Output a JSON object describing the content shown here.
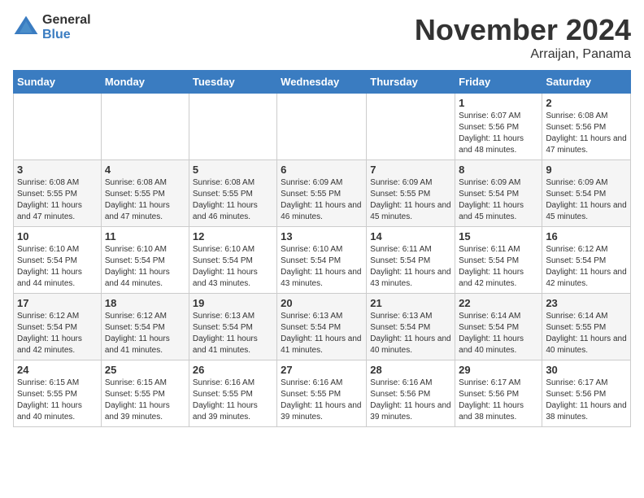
{
  "logo": {
    "general": "General",
    "blue": "Blue"
  },
  "title": "November 2024",
  "location": "Arraijan, Panama",
  "days_of_week": [
    "Sunday",
    "Monday",
    "Tuesday",
    "Wednesday",
    "Thursday",
    "Friday",
    "Saturday"
  ],
  "weeks": [
    [
      {
        "day": "",
        "info": ""
      },
      {
        "day": "",
        "info": ""
      },
      {
        "day": "",
        "info": ""
      },
      {
        "day": "",
        "info": ""
      },
      {
        "day": "",
        "info": ""
      },
      {
        "day": "1",
        "info": "Sunrise: 6:07 AM\nSunset: 5:56 PM\nDaylight: 11 hours and 48 minutes."
      },
      {
        "day": "2",
        "info": "Sunrise: 6:08 AM\nSunset: 5:56 PM\nDaylight: 11 hours and 47 minutes."
      }
    ],
    [
      {
        "day": "3",
        "info": "Sunrise: 6:08 AM\nSunset: 5:55 PM\nDaylight: 11 hours and 47 minutes."
      },
      {
        "day": "4",
        "info": "Sunrise: 6:08 AM\nSunset: 5:55 PM\nDaylight: 11 hours and 47 minutes."
      },
      {
        "day": "5",
        "info": "Sunrise: 6:08 AM\nSunset: 5:55 PM\nDaylight: 11 hours and 46 minutes."
      },
      {
        "day": "6",
        "info": "Sunrise: 6:09 AM\nSunset: 5:55 PM\nDaylight: 11 hours and 46 minutes."
      },
      {
        "day": "7",
        "info": "Sunrise: 6:09 AM\nSunset: 5:55 PM\nDaylight: 11 hours and 45 minutes."
      },
      {
        "day": "8",
        "info": "Sunrise: 6:09 AM\nSunset: 5:54 PM\nDaylight: 11 hours and 45 minutes."
      },
      {
        "day": "9",
        "info": "Sunrise: 6:09 AM\nSunset: 5:54 PM\nDaylight: 11 hours and 45 minutes."
      }
    ],
    [
      {
        "day": "10",
        "info": "Sunrise: 6:10 AM\nSunset: 5:54 PM\nDaylight: 11 hours and 44 minutes."
      },
      {
        "day": "11",
        "info": "Sunrise: 6:10 AM\nSunset: 5:54 PM\nDaylight: 11 hours and 44 minutes."
      },
      {
        "day": "12",
        "info": "Sunrise: 6:10 AM\nSunset: 5:54 PM\nDaylight: 11 hours and 43 minutes."
      },
      {
        "day": "13",
        "info": "Sunrise: 6:10 AM\nSunset: 5:54 PM\nDaylight: 11 hours and 43 minutes."
      },
      {
        "day": "14",
        "info": "Sunrise: 6:11 AM\nSunset: 5:54 PM\nDaylight: 11 hours and 43 minutes."
      },
      {
        "day": "15",
        "info": "Sunrise: 6:11 AM\nSunset: 5:54 PM\nDaylight: 11 hours and 42 minutes."
      },
      {
        "day": "16",
        "info": "Sunrise: 6:12 AM\nSunset: 5:54 PM\nDaylight: 11 hours and 42 minutes."
      }
    ],
    [
      {
        "day": "17",
        "info": "Sunrise: 6:12 AM\nSunset: 5:54 PM\nDaylight: 11 hours and 42 minutes."
      },
      {
        "day": "18",
        "info": "Sunrise: 6:12 AM\nSunset: 5:54 PM\nDaylight: 11 hours and 41 minutes."
      },
      {
        "day": "19",
        "info": "Sunrise: 6:13 AM\nSunset: 5:54 PM\nDaylight: 11 hours and 41 minutes."
      },
      {
        "day": "20",
        "info": "Sunrise: 6:13 AM\nSunset: 5:54 PM\nDaylight: 11 hours and 41 minutes."
      },
      {
        "day": "21",
        "info": "Sunrise: 6:13 AM\nSunset: 5:54 PM\nDaylight: 11 hours and 40 minutes."
      },
      {
        "day": "22",
        "info": "Sunrise: 6:14 AM\nSunset: 5:54 PM\nDaylight: 11 hours and 40 minutes."
      },
      {
        "day": "23",
        "info": "Sunrise: 6:14 AM\nSunset: 5:55 PM\nDaylight: 11 hours and 40 minutes."
      }
    ],
    [
      {
        "day": "24",
        "info": "Sunrise: 6:15 AM\nSunset: 5:55 PM\nDaylight: 11 hours and 40 minutes."
      },
      {
        "day": "25",
        "info": "Sunrise: 6:15 AM\nSunset: 5:55 PM\nDaylight: 11 hours and 39 minutes."
      },
      {
        "day": "26",
        "info": "Sunrise: 6:16 AM\nSunset: 5:55 PM\nDaylight: 11 hours and 39 minutes."
      },
      {
        "day": "27",
        "info": "Sunrise: 6:16 AM\nSunset: 5:55 PM\nDaylight: 11 hours and 39 minutes."
      },
      {
        "day": "28",
        "info": "Sunrise: 6:16 AM\nSunset: 5:56 PM\nDaylight: 11 hours and 39 minutes."
      },
      {
        "day": "29",
        "info": "Sunrise: 6:17 AM\nSunset: 5:56 PM\nDaylight: 11 hours and 38 minutes."
      },
      {
        "day": "30",
        "info": "Sunrise: 6:17 AM\nSunset: 5:56 PM\nDaylight: 11 hours and 38 minutes."
      }
    ]
  ]
}
